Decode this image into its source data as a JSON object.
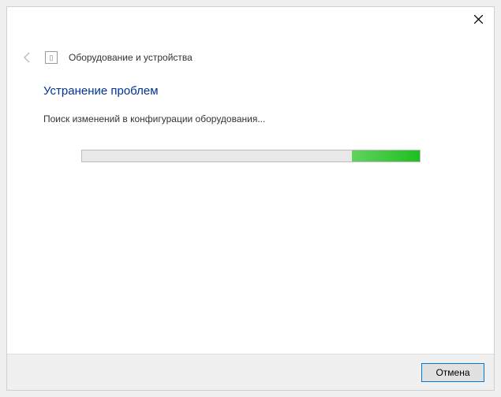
{
  "header": {
    "breadcrumb": "Оборудование и устройства"
  },
  "content": {
    "heading": "Устранение проблем",
    "status": "Поиск изменений в конфигурации оборудования...",
    "progress_percent": 20
  },
  "footer": {
    "cancel_label": "Отмена"
  }
}
